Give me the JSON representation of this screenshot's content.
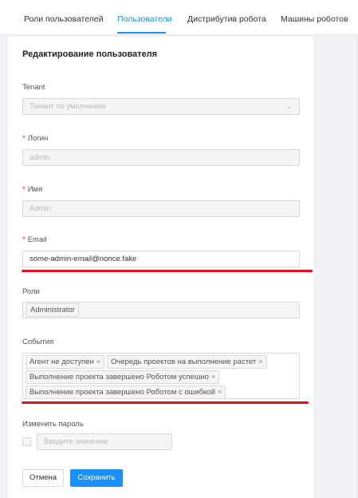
{
  "tabs": [
    {
      "label": "Роли пользователей",
      "active": false
    },
    {
      "label": "Пользователи",
      "active": true
    },
    {
      "label": "Дистрибутив робота",
      "active": false
    },
    {
      "label": "Машины роботов",
      "active": false
    }
  ],
  "form": {
    "title": "Редактирование пользователя",
    "tenant": {
      "label": "Tenant",
      "value": "Тенант по умолчанию"
    },
    "login": {
      "label": "Логин",
      "value": "admin",
      "required": true
    },
    "name": {
      "label": "Имя",
      "value": "Admin",
      "required": true
    },
    "email": {
      "label": "Email",
      "value": "some-admin-email@nonce.fake",
      "required": true
    },
    "roles": {
      "label": "Роли",
      "tags": [
        "Administrator"
      ]
    },
    "events": {
      "label": "События",
      "tags": [
        "Агент не доступен",
        "Очередь проектов на выполнение растет",
        "Выполнение проекта завершено Роботом успешно",
        "Выполнение проекта завершено Роботом с ошибкой"
      ]
    },
    "change_password": {
      "label": "Изменить пароль",
      "placeholder": "Введите значение",
      "checked": false
    }
  },
  "buttons": {
    "cancel": "Отмена",
    "save": "Сохранить"
  },
  "required_marker": "*",
  "tag_close_glyph": "×",
  "colors": {
    "accent": "#1890ff",
    "required": "#f5222d",
    "annotation": "#e01020"
  }
}
